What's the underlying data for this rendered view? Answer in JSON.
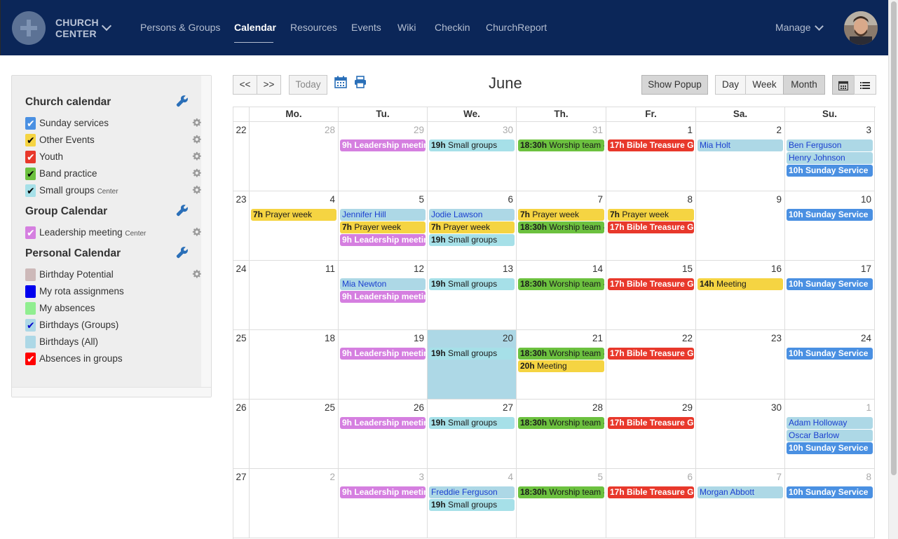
{
  "app": {
    "brand_line1": "CHURCH",
    "brand_line2": "CENTER"
  },
  "nav": [
    {
      "label": "Persons & Groups",
      "active": false
    },
    {
      "label": "Calendar",
      "active": true
    },
    {
      "label": "Resources",
      "active": false
    },
    {
      "label": "Events",
      "active": false
    },
    {
      "label": "Wiki",
      "active": false
    },
    {
      "label": "Checkin",
      "active": false
    },
    {
      "label": "ChurchReport",
      "active": false
    }
  ],
  "manage_label": "Manage",
  "sidebar": {
    "sections": [
      {
        "title": "Church calendar",
        "items": [
          {
            "label": "Sunday services",
            "tag": "",
            "color": "#4a90e2",
            "checked": true,
            "check_color": "#ffffff",
            "gear": true
          },
          {
            "label": "Other Events",
            "tag": "",
            "color": "#f5d442",
            "checked": true,
            "check_color": "#000000",
            "gear": true
          },
          {
            "label": "Youth",
            "tag": "",
            "color": "#e8382b",
            "checked": true,
            "check_color": "#ffffff",
            "gear": true
          },
          {
            "label": "Band practice",
            "tag": "",
            "color": "#6cc13f",
            "checked": true,
            "check_color": "#000000",
            "gear": true
          },
          {
            "label": "Small groups",
            "tag": "Center",
            "color": "#a6e0e8",
            "checked": true,
            "check_color": "#000000",
            "gear": true
          }
        ]
      },
      {
        "title": "Group Calendar",
        "items": [
          {
            "label": "Leadership meeting",
            "tag": "Center",
            "color": "#d57fe0",
            "checked": true,
            "check_color": "#ffffff",
            "gear": true
          }
        ]
      },
      {
        "title": "Personal Calendar",
        "items": [
          {
            "label": "Birthday Potential",
            "tag": "",
            "color": "#cdb9b9",
            "checked": false,
            "check_color": "#000000",
            "gear": true
          },
          {
            "label": "My rota assignmens",
            "tag": "",
            "color": "#0000ee",
            "checked": false,
            "check_color": "#ffffff",
            "gear": false
          },
          {
            "label": "My absences",
            "tag": "",
            "color": "#90ee90",
            "checked": false,
            "check_color": "#000000",
            "gear": false
          },
          {
            "label": "Birthdays (Groups)",
            "tag": "",
            "color": "#add8e6",
            "checked": true,
            "check_color": "#0000cc",
            "gear": false
          },
          {
            "label": "Birthdays (All)",
            "tag": "",
            "color": "#add8e6",
            "checked": false,
            "check_color": "#000000",
            "gear": false
          },
          {
            "label": "Absences in groups",
            "tag": "",
            "color": "#ff0000",
            "checked": true,
            "check_color": "#ffffff",
            "gear": false
          }
        ]
      }
    ]
  },
  "toolbar": {
    "prev_label": "<<",
    "next_label": ">>",
    "today_label": "Today",
    "month_title": "June",
    "show_popup_label": "Show Popup",
    "day_label": "Day",
    "week_label": "Week",
    "month_label": "Month",
    "active_view": "Month"
  },
  "calendar": {
    "weekdays": [
      "Mo.",
      "Tu.",
      "We.",
      "Th.",
      "Fr.",
      "Sa.",
      "Su."
    ],
    "colors": {
      "leader": "#d57fe0",
      "small": "#a6e0e8",
      "worship": "#6cc13f",
      "bible": "#e8382b",
      "birthday": "#add8e6",
      "sunday": "#4a90e2",
      "prayer": "#f5d442",
      "meeting": "#f5d442"
    },
    "weeks": [
      {
        "num": "22",
        "days": [
          {
            "n": "28",
            "other": true,
            "events": []
          },
          {
            "n": "29",
            "other": true,
            "events": [
              {
                "t": "9h",
                "l": "Leadership meeting",
                "c": "leader"
              }
            ]
          },
          {
            "n": "30",
            "other": true,
            "events": [
              {
                "t": "19h",
                "l": "Small groups",
                "c": "small"
              }
            ]
          },
          {
            "n": "31",
            "other": true,
            "events": [
              {
                "t": "18:30h",
                "l": "Worship team -",
                "c": "worship"
              }
            ]
          },
          {
            "n": "1",
            "other": false,
            "events": [
              {
                "t": "17h",
                "l": "Bible Treasure Gro",
                "c": "bible"
              }
            ]
          },
          {
            "n": "2",
            "other": false,
            "events": [
              {
                "t": "",
                "l": "Mia Holt",
                "c": "birthday"
              }
            ]
          },
          {
            "n": "3",
            "other": false,
            "events": [
              {
                "t": "",
                "l": "Ben Ferguson",
                "c": "birthday"
              },
              {
                "t": "",
                "l": "Henry Johnson",
                "c": "birthday"
              },
              {
                "t": "10h",
                "l": "Sunday Service",
                "c": "sunday"
              }
            ]
          }
        ]
      },
      {
        "num": "23",
        "days": [
          {
            "n": "4",
            "other": false,
            "events": [
              {
                "t": "7h",
                "l": "Prayer week",
                "c": "prayer"
              }
            ]
          },
          {
            "n": "5",
            "other": false,
            "events": [
              {
                "t": "",
                "l": "Jennifer Hill",
                "c": "birthday"
              },
              {
                "t": "7h",
                "l": "Prayer week",
                "c": "prayer"
              },
              {
                "t": "9h",
                "l": "Leadership meeting",
                "c": "leader"
              }
            ]
          },
          {
            "n": "6",
            "other": false,
            "events": [
              {
                "t": "",
                "l": "Jodie Lawson",
                "c": "birthday"
              },
              {
                "t": "7h",
                "l": "Prayer week",
                "c": "prayer"
              },
              {
                "t": "19h",
                "l": "Small groups",
                "c": "small"
              }
            ]
          },
          {
            "n": "7",
            "other": false,
            "events": [
              {
                "t": "7h",
                "l": "Prayer week",
                "c": "prayer"
              },
              {
                "t": "18:30h",
                "l": "Worship team -",
                "c": "worship"
              }
            ]
          },
          {
            "n": "8",
            "other": false,
            "events": [
              {
                "t": "7h",
                "l": "Prayer week",
                "c": "prayer"
              },
              {
                "t": "17h",
                "l": "Bible Treasure Gro",
                "c": "bible"
              }
            ]
          },
          {
            "n": "9",
            "other": false,
            "events": []
          },
          {
            "n": "10",
            "other": false,
            "events": [
              {
                "t": "10h",
                "l": "Sunday Service",
                "c": "sunday"
              }
            ]
          }
        ]
      },
      {
        "num": "24",
        "days": [
          {
            "n": "11",
            "other": false,
            "events": []
          },
          {
            "n": "12",
            "other": false,
            "events": [
              {
                "t": "",
                "l": "Mia Newton",
                "c": "birthday"
              },
              {
                "t": "9h",
                "l": "Leadership meeting",
                "c": "leader"
              }
            ]
          },
          {
            "n": "13",
            "other": false,
            "events": [
              {
                "t": "19h",
                "l": "Small groups",
                "c": "small"
              }
            ]
          },
          {
            "n": "14",
            "other": false,
            "events": [
              {
                "t": "18:30h",
                "l": "Worship team -",
                "c": "worship"
              }
            ]
          },
          {
            "n": "15",
            "other": false,
            "events": [
              {
                "t": "17h",
                "l": "Bible Treasure Gro",
                "c": "bible"
              }
            ]
          },
          {
            "n": "16",
            "other": false,
            "events": [
              {
                "t": "14h",
                "l": "Meeting",
                "c": "meeting"
              }
            ]
          },
          {
            "n": "17",
            "other": false,
            "events": [
              {
                "t": "10h",
                "l": "Sunday Service",
                "c": "sunday"
              }
            ]
          }
        ]
      },
      {
        "num": "25",
        "days": [
          {
            "n": "18",
            "other": false,
            "events": []
          },
          {
            "n": "19",
            "other": false,
            "events": [
              {
                "t": "9h",
                "l": "Leadership meeting",
                "c": "leader"
              }
            ]
          },
          {
            "n": "20",
            "other": false,
            "today": true,
            "events": [
              {
                "t": "19h",
                "l": "Small groups",
                "c": "small"
              }
            ]
          },
          {
            "n": "21",
            "other": false,
            "events": [
              {
                "t": "18:30h",
                "l": "Worship team -",
                "c": "worship"
              },
              {
                "t": "20h",
                "l": "Meeting",
                "c": "meeting"
              }
            ]
          },
          {
            "n": "22",
            "other": false,
            "events": [
              {
                "t": "17h",
                "l": "Bible Treasure Gro",
                "c": "bible"
              }
            ]
          },
          {
            "n": "23",
            "other": false,
            "events": []
          },
          {
            "n": "24",
            "other": false,
            "events": [
              {
                "t": "10h",
                "l": "Sunday Service",
                "c": "sunday"
              }
            ]
          }
        ]
      },
      {
        "num": "26",
        "days": [
          {
            "n": "25",
            "other": false,
            "events": []
          },
          {
            "n": "26",
            "other": false,
            "events": [
              {
                "t": "9h",
                "l": "Leadership meeting",
                "c": "leader"
              }
            ]
          },
          {
            "n": "27",
            "other": false,
            "events": [
              {
                "t": "19h",
                "l": "Small groups",
                "c": "small"
              }
            ]
          },
          {
            "n": "28",
            "other": false,
            "events": [
              {
                "t": "18:30h",
                "l": "Worship team -",
                "c": "worship"
              }
            ]
          },
          {
            "n": "29",
            "other": false,
            "events": [
              {
                "t": "17h",
                "l": "Bible Treasure Gro",
                "c": "bible"
              }
            ]
          },
          {
            "n": "30",
            "other": false,
            "events": []
          },
          {
            "n": "1",
            "other": true,
            "events": [
              {
                "t": "",
                "l": "Adam Holloway",
                "c": "birthday"
              },
              {
                "t": "",
                "l": "Oscar Barlow",
                "c": "birthday"
              },
              {
                "t": "10h",
                "l": "Sunday Service",
                "c": "sunday"
              }
            ]
          }
        ]
      },
      {
        "num": "27",
        "days": [
          {
            "n": "2",
            "other": true,
            "events": []
          },
          {
            "n": "3",
            "other": true,
            "events": [
              {
                "t": "9h",
                "l": "Leadership meeting",
                "c": "leader"
              }
            ]
          },
          {
            "n": "4",
            "other": true,
            "events": [
              {
                "t": "",
                "l": "Freddie Ferguson",
                "c": "birthday"
              },
              {
                "t": "19h",
                "l": "Small groups",
                "c": "small"
              }
            ]
          },
          {
            "n": "5",
            "other": true,
            "events": [
              {
                "t": "18:30h",
                "l": "Worship team -",
                "c": "worship"
              }
            ]
          },
          {
            "n": "6",
            "other": true,
            "events": [
              {
                "t": "17h",
                "l": "Bible Treasure Gro",
                "c": "bible"
              }
            ]
          },
          {
            "n": "7",
            "other": true,
            "events": [
              {
                "t": "",
                "l": "Morgan Abbott",
                "c": "birthday"
              }
            ]
          },
          {
            "n": "8",
            "other": true,
            "events": [
              {
                "t": "10h",
                "l": "Sunday Service",
                "c": "sunday"
              }
            ]
          }
        ]
      }
    ]
  }
}
